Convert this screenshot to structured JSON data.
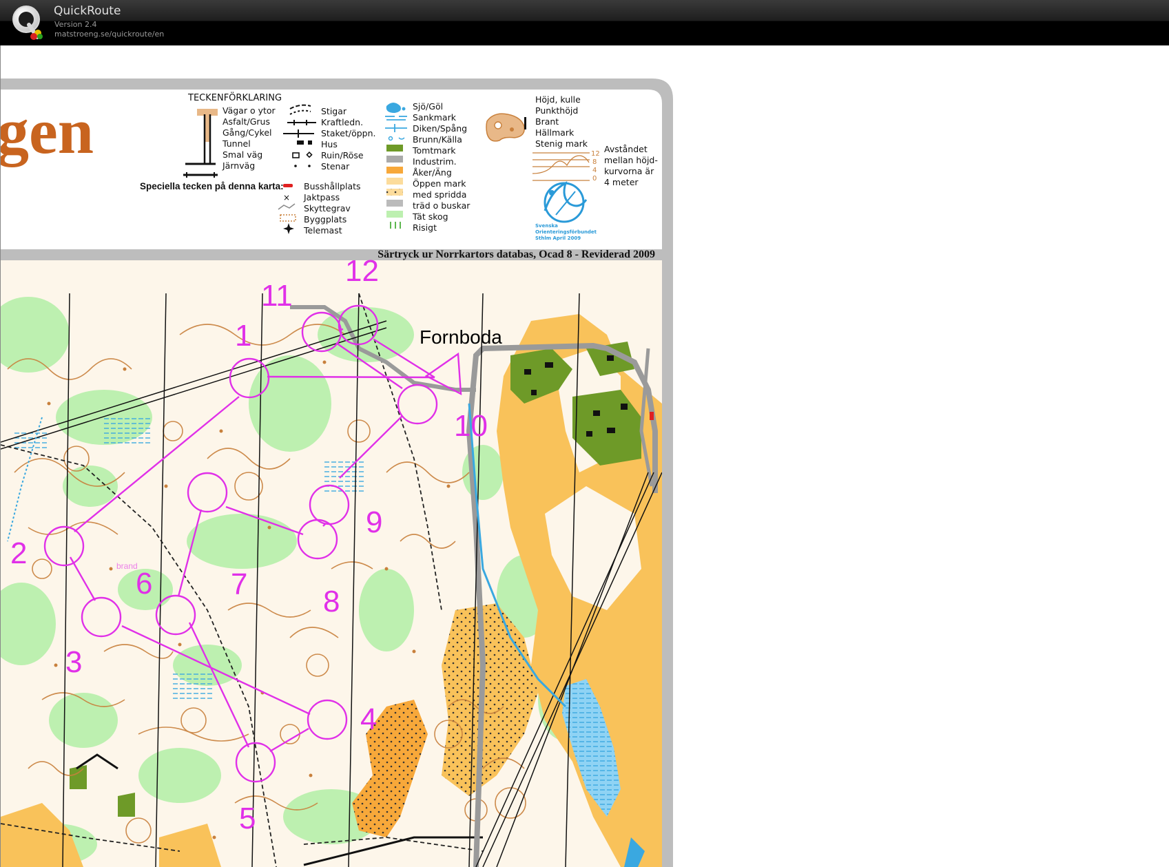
{
  "app": {
    "name": "QuickRoute",
    "version": "Version 2.4",
    "url": "matstroeng.se/quickroute/en"
  },
  "map": {
    "title_fragment": "gen",
    "legend_title": "TECKENFÖRKLARING",
    "legend_col1": [
      "Vägar o ytor",
      "Asfalt/Grus",
      "Gång/Cykel",
      "Tunnel",
      "Smal väg",
      "Järnväg"
    ],
    "legend_col2": [
      "Stigar",
      "Kraftledn.",
      "Staket/öppn.",
      "Hus",
      "Ruin/Röse",
      "Stenar"
    ],
    "legend_col3": [
      "Sjö/Göl",
      "Sankmark",
      "Diken/Spång",
      "Brunn/Källa",
      "Tomtmark",
      "Industrim.",
      "Åker/Äng",
      "Öppen mark",
      "med spridda",
      "träd o buskar",
      "Tät skog",
      "Risigt"
    ],
    "legend_col4": [
      "Höjd, kulle",
      "Punkthöjd",
      "Brant",
      "Hällmark",
      "Stenig mark"
    ],
    "contour_text": [
      "Avståndet",
      "mellan höjd-",
      "kurvorna är",
      "4 meter"
    ],
    "contour_numbers": [
      "12",
      "8",
      "4",
      "0"
    ],
    "special_title": "Speciella tecken på denna karta:",
    "special_items": [
      "Busshållplats",
      "Jaktpass",
      "Skyttegrav",
      "Byggplats",
      "Telemast"
    ],
    "sof_text": [
      "Svenska",
      "Orienteringsförbundet",
      "Sthlm April 2009"
    ],
    "revision": "Särtryck ur Norrkartors databas, Ocad 8 - Reviderad 2009",
    "place_name": "Fornboda",
    "small_label": "brand"
  },
  "course": {
    "color": "#e030e8",
    "controls": [
      "1",
      "2",
      "3",
      "4",
      "5",
      "6",
      "7",
      "8",
      "9",
      "10",
      "11",
      "12"
    ]
  },
  "colors": {
    "map_background": "#fdf6ea",
    "forest_green": "#bdf0b0",
    "open_yellow": "#f9c25a",
    "settlement_olive": "#6e9a28",
    "water_blue": "#3aa8e0",
    "contour_brown": "#c8803c",
    "title_orange": "#c8641f"
  }
}
